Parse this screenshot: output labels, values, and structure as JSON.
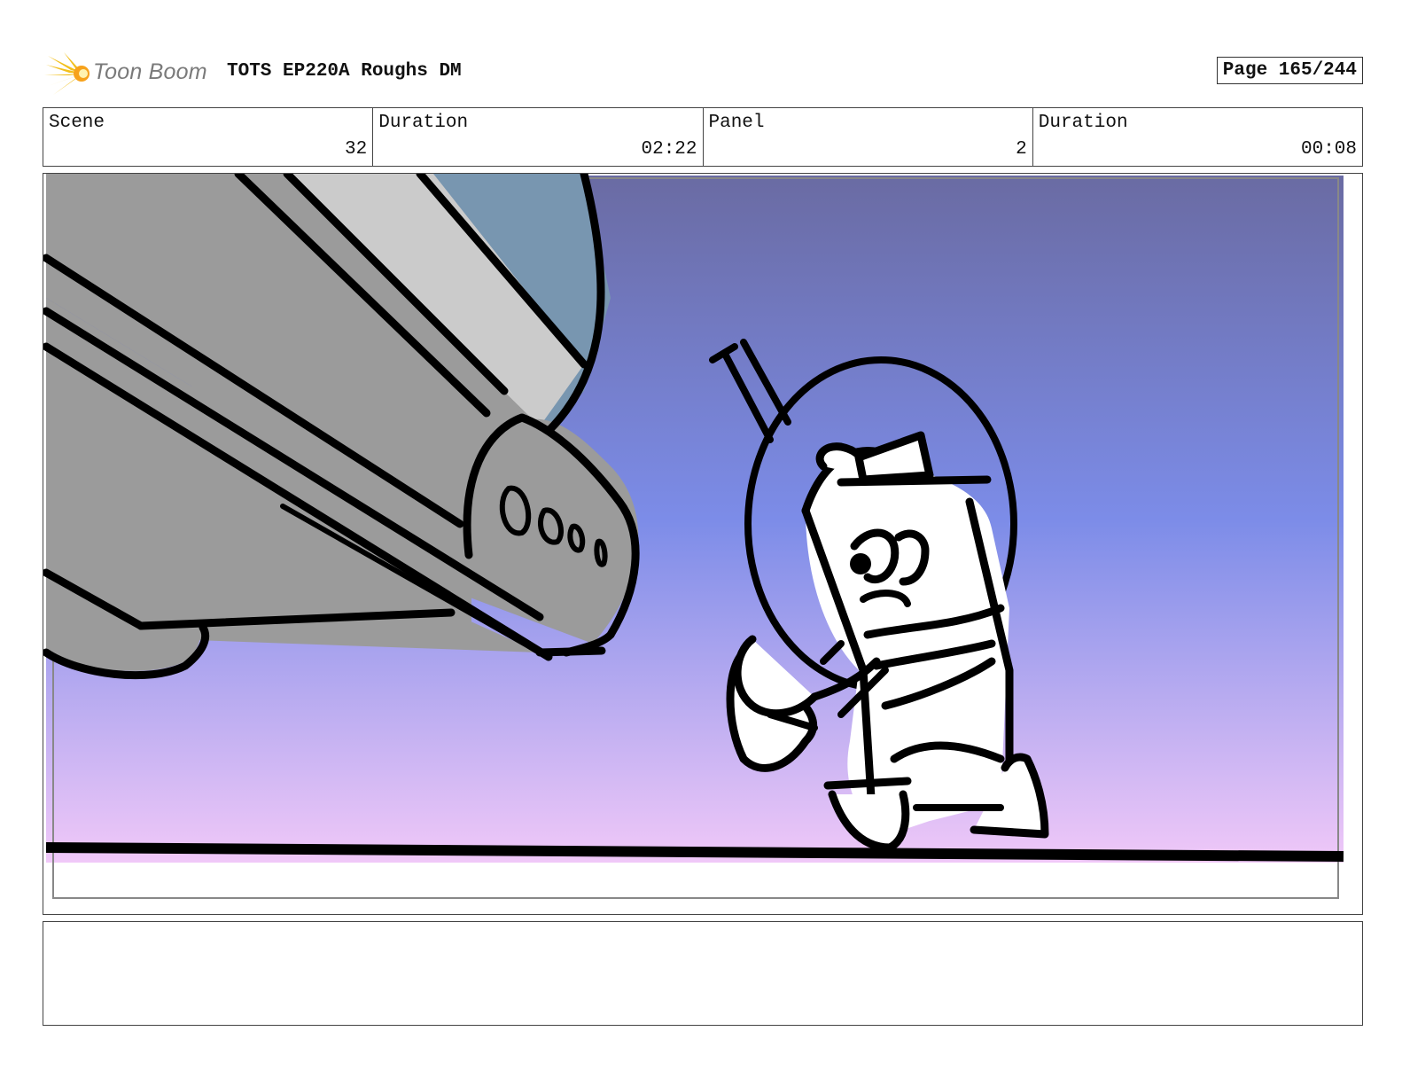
{
  "header": {
    "logo_text": "Toon Boom",
    "title": "TOTS EP220A Roughs DM",
    "page": "Page 165/244"
  },
  "info": {
    "scene_label": "Scene",
    "scene_value": "32",
    "scene_duration_label": "Duration",
    "scene_duration_value": "02:22",
    "panel_label": "Panel",
    "panel_value": "2",
    "panel_duration_label": "Duration",
    "panel_duration_value": "00:08"
  },
  "panel": {
    "sky_top_color": "#6a6ba3",
    "sky_mid_color": "#7c8ce8",
    "sky_bottom_color": "#f0c8f8",
    "ship_color": "#9b9b9b",
    "ship_light_color": "#cbcbcb",
    "cockpit_color": "#7896b0"
  },
  "notes": {
    "text": ""
  }
}
